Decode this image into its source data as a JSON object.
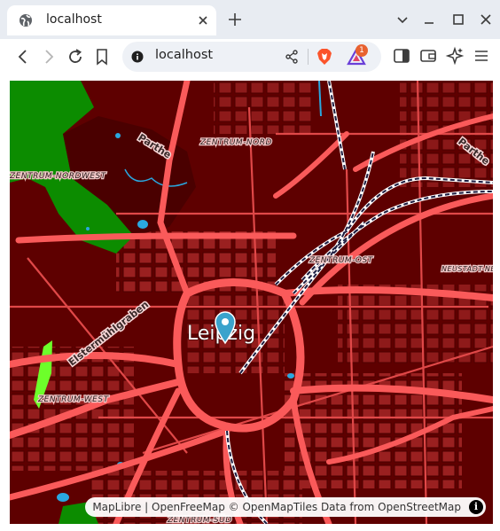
{
  "browser": {
    "tab_title": "localhost",
    "url": "localhost",
    "rewards_badge": "1"
  },
  "map": {
    "city_label": "Leipzig",
    "districts": [
      "ZENTRUM-NORD",
      "ZENTRUM-OST",
      "ZENTRUM-NORDWEST",
      "ZENTRUM-WEST",
      "NEUSTADT-NEUSCHÖNEFELD",
      "ZENTRUM-SÜD"
    ],
    "streets": [
      "Parthe",
      "Elstermühlgraben",
      "Parthe"
    ],
    "colors": {
      "background": "#5e0000",
      "blocks": "#9a2020",
      "major_road": "#fa5a5a",
      "park": "#0c8c00",
      "meadow": "#6dff2a",
      "water": "#2aa8e0",
      "rail": "#1c1c40",
      "marker": "#3aa3cc"
    }
  },
  "attribution": {
    "maplibre": "MapLibre",
    "sep": " | ",
    "openfreemap": "OpenFreeMap",
    "copy": " © ",
    "openmaptiles": "OpenMapTiles",
    "data_from": " Data from ",
    "osm": "OpenStreetMap",
    "info": "i"
  }
}
